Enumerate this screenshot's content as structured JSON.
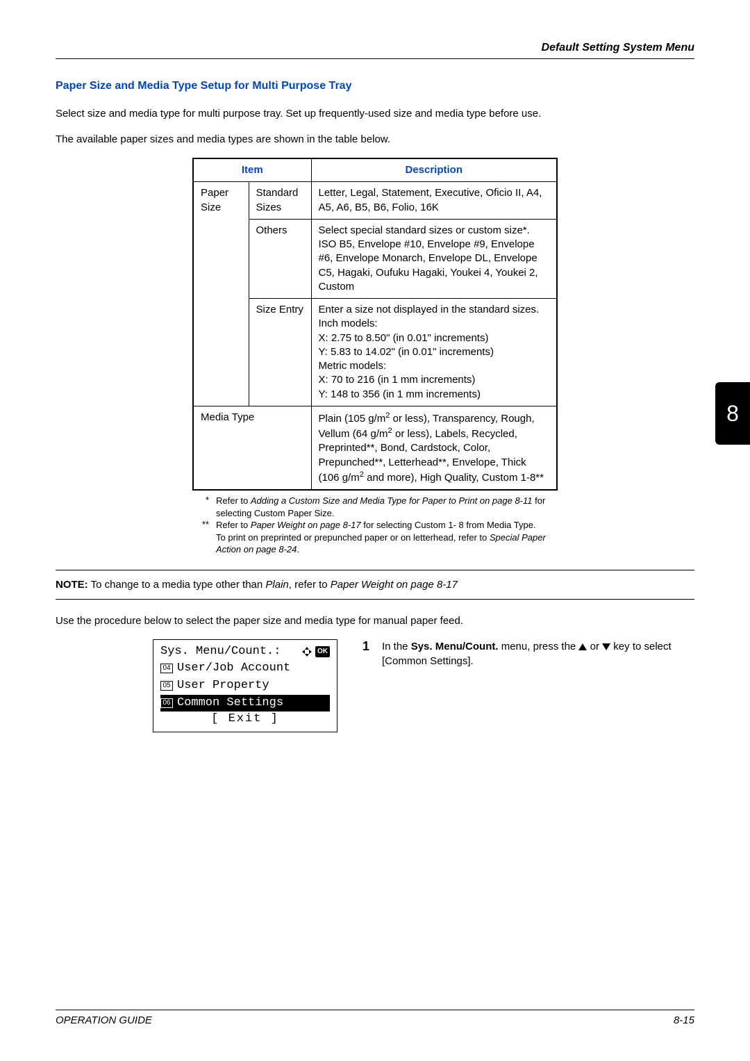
{
  "header": {
    "title": "Default Setting System Menu"
  },
  "section": {
    "heading": "Paper Size and Media Type Setup for Multi Purpose Tray",
    "intro1": "Select size and media type for multi purpose tray. Set up frequently-used size and media type before use.",
    "intro2": "The available paper sizes and media types are shown in the table below."
  },
  "table": {
    "headers": {
      "item": "Item",
      "description": "Description"
    },
    "paper_size_label": "Paper Size",
    "standard_sizes_label": "Standard Sizes",
    "standard_sizes_desc": "Letter, Legal, Statement, Executive, Oficio II, A4, A5, A6, B5, B6, Folio, 16K",
    "others_label": "Others",
    "others_desc": "Select special standard sizes or custom size*. ISO B5, Envelope #10, Envelope #9, Envelope #6, Envelope Monarch, Envelope DL, Envelope C5, Hagaki, Oufuku Hagaki, Youkei 4, Youkei 2, Custom",
    "size_entry_label": "Size Entry",
    "size_entry_desc_1": "Enter a size not displayed in the standard sizes.",
    "size_entry_desc_2": "Inch models:",
    "size_entry_desc_3": "X: 2.75 to 8.50\" (in 0.01\" increments)",
    "size_entry_desc_4": "Y: 5.83 to 14.02\" (in 0.01\" increments)",
    "size_entry_desc_5": "Metric models:",
    "size_entry_desc_6": "X: 70 to 216 (in 1 mm increments)",
    "size_entry_desc_7": "Y: 148 to 356 (in 1 mm increments)",
    "media_type_label": "Media Type",
    "media_type_desc_pre": "Plain (105 g/m",
    "media_type_desc_mid1": " or less), Transparency, Rough, Vellum (64 g/m",
    "media_type_desc_mid2": " or less), Labels, Recycled, Preprinted**, Bond, Cardstock, Color, Prepunched**, Letterhead**, Envelope, Thick (106 g/m",
    "media_type_desc_end": " and more), High Quality, Custom 1-8**"
  },
  "footnotes": {
    "star_mark": "*",
    "star_text_pre": "Refer to ",
    "star_text_em": "Adding a Custom Size and Media Type for Paper to Print on page 8-11",
    "star_text_post": " for selecting Custom Paper Size.",
    "dstar_mark": "**",
    "dstar_text_pre": "Refer to ",
    "dstar_text_em": "Paper Weight on page 8-17",
    "dstar_text_post": " for selecting Custom 1- 8 from Media Type.",
    "dstar_text_line2": "To print on preprinted or prepunched paper or on letterhead, refer to ",
    "dstar_text_line2_em": "Special Paper Action on page 8-24",
    "dstar_text_line2_end": "."
  },
  "note": {
    "label": "NOTE:",
    "pre": " To change to a media type other than ",
    "em1": "Plain",
    "mid": ", refer to ",
    "em2": "Paper Weight on page 8-17"
  },
  "procedure_intro": "Use the procedure below to select the paper size and media type for manual paper feed.",
  "lcd": {
    "title": "Sys. Menu/Count.:",
    "ok": "OK",
    "items": [
      {
        "num": "04",
        "label": "User/Job Account"
      },
      {
        "num": "05",
        "label": "User Property"
      },
      {
        "num": "06",
        "label": "Common Settings"
      }
    ],
    "exit": "[  Exit  ]"
  },
  "step": {
    "num": "1",
    "pre": "In the ",
    "bold": "Sys. Menu/Count.",
    "mid": " menu, press the ",
    "or": " or ",
    "post": " key to select [Common Settings]."
  },
  "footer": {
    "left": "OPERATION GUIDE",
    "right": "8-15"
  },
  "sidetab": "8",
  "chart_data": null
}
